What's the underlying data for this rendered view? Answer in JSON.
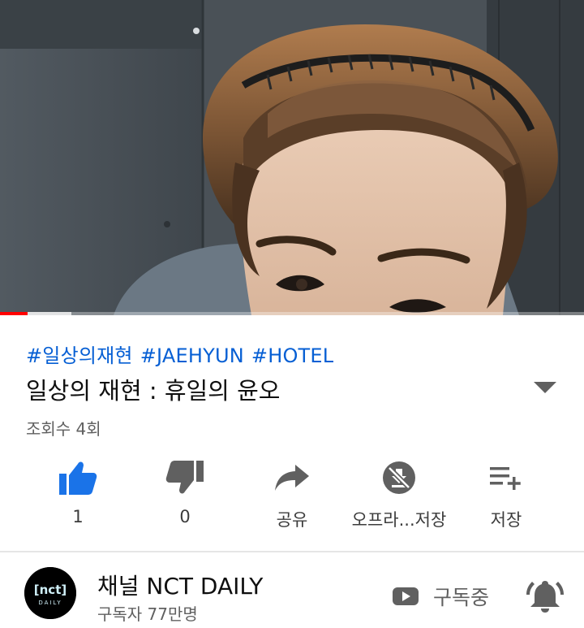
{
  "video": {
    "progress_played_fraction": 0.047,
    "progress_buffered_fraction": 0.122
  },
  "meta": {
    "hashtags": [
      "#일상의재현",
      "#JAEHYUN",
      "#HOTEL"
    ],
    "title": "일상의 재현 : 휴일의 윤오",
    "views": "조회수 4회"
  },
  "actions": {
    "like_count": "1",
    "dislike_count": "0",
    "share_label": "공유",
    "offline_label": "오프라...저장",
    "save_label": "저장"
  },
  "channel": {
    "name": "채널 NCT DAILY",
    "subscribers": "구독자 77만명",
    "avatar_text_top": "[nct]",
    "avatar_text_bottom": "DAILY",
    "subscribed_label": "구독중"
  },
  "colors": {
    "accent_blue": "#065fd4",
    "like_blue": "#1a73e8",
    "icon_gray": "#606060",
    "progress_red": "#ff0000"
  },
  "icons": {
    "like": "thumbs-up-icon",
    "dislike": "thumbs-down-icon",
    "share": "share-arrow-icon",
    "offline": "download-disabled-icon",
    "save": "playlist-add-icon",
    "expand": "triangle-down-icon",
    "subscribed": "youtube-play-icon",
    "bell": "bell-ringing-icon"
  }
}
